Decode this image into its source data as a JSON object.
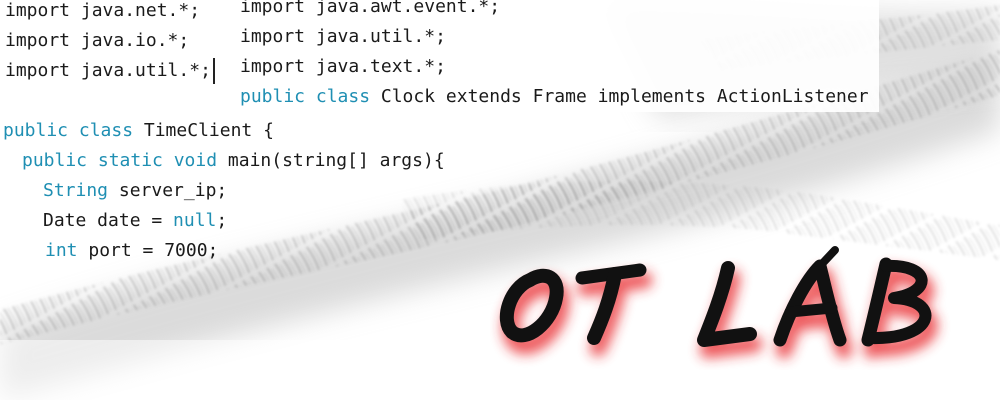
{
  "left_imports": {
    "lines": [
      "import java.net.*;",
      "import java.io.*;",
      "import java.util.*;"
    ]
  },
  "right_imports": {
    "lines": [
      "import java.awt.event.*;",
      "import java.util.*;",
      "import java.text.*;"
    ],
    "clock_keyword": "public class",
    "clock_rest": " Clock extends Frame implements ActionListener"
  },
  "client_code": {
    "line1_keyword": "public class",
    "line1_rest": " TimeClient {",
    "line2_keyword": "public static void",
    "line2_rest": " main(string[] args){",
    "line3_keyword": "String",
    "line3_rest": " server_ip;",
    "line4_prefix": "Date date = ",
    "line4_keyword": "null",
    "line4_suffix": ";",
    "line5_keyword": "int",
    "line5_rest": " port = 7000;"
  },
  "logo": {
    "text": "OT LAB",
    "ink_color": "#111111",
    "glow_color": "#e8262a"
  },
  "colors": {
    "keyword": "#1f8fb3",
    "code_text": "#1a1a1a",
    "background": "#ffffff"
  }
}
